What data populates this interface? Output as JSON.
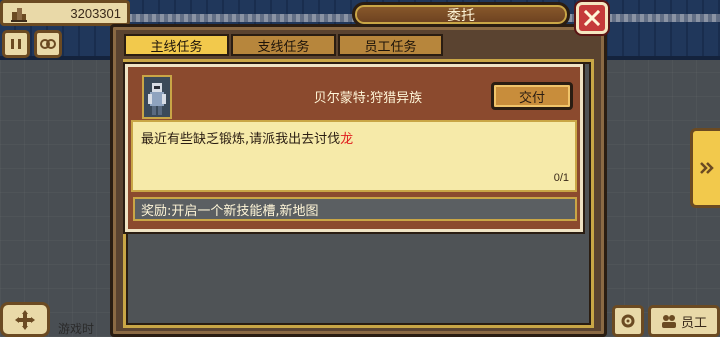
{
  "hud": {
    "money": "3203301",
    "money_icon": "buildings-icon",
    "pause_icon": "pause-icon",
    "speed_icon": "speed-icon"
  },
  "modal": {
    "title": "委托",
    "close_icon": "close-icon",
    "tabs": [
      {
        "label": "主线任务",
        "active": true
      },
      {
        "label": "支线任务",
        "active": false
      },
      {
        "label": "员工任务",
        "active": false
      }
    ],
    "quest": {
      "title": "贝尔蒙特:狩猎异族",
      "deliver_label": "交付",
      "description": "最近有些缺乏锻炼,请派我出去讨伐",
      "description_highlight": "龙",
      "progress": "0/1",
      "reward": "奖励:开启一个新技能槽,新地图"
    }
  },
  "side_arrow_icon": "double-chevron-right-icon",
  "bottom": {
    "move_icon": "move-arrows-icon",
    "game_time": "游戏时",
    "settings_icon": "gear-icon",
    "staff_label": "员工"
  },
  "colors": {
    "accent_gold": "#f2c94c",
    "panel_brown": "#8b4a2e",
    "desc_bg": "#f6eaa9",
    "close_red": "#c53a3a",
    "highlight_red": "#e02020"
  }
}
